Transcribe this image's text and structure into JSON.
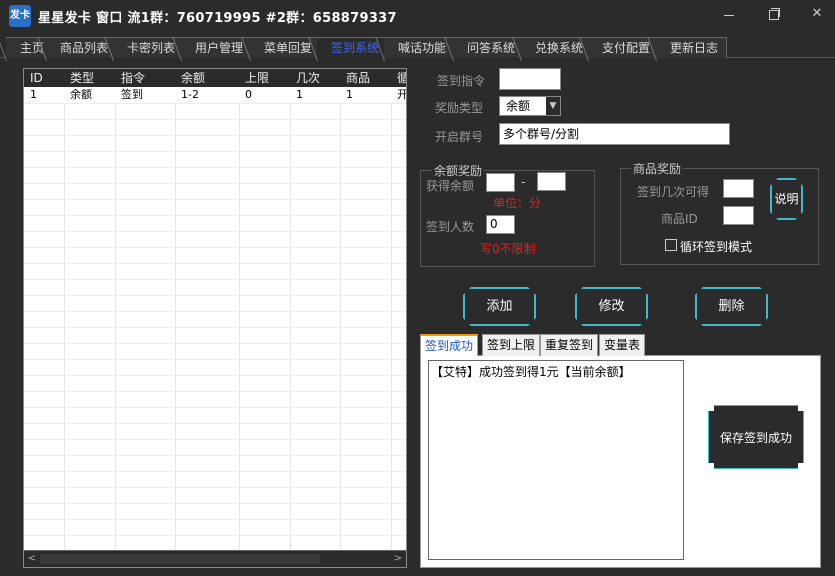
{
  "window": {
    "icon_text": "发卡",
    "title": "星星发卡 窗口 流1群：760719995 #2群：658879337"
  },
  "tabs": [
    {
      "label": "主页"
    },
    {
      "label": "商品列表"
    },
    {
      "label": "卡密列表"
    },
    {
      "label": "用户管理"
    },
    {
      "label": "菜单回复"
    },
    {
      "label": "签到系统"
    },
    {
      "label": "喊话功能"
    },
    {
      "label": "问答系统"
    },
    {
      "label": "兑换系统"
    },
    {
      "label": "支付配置"
    },
    {
      "label": "更新日志"
    }
  ],
  "active_tab": "签到系统",
  "table": {
    "columns": [
      "ID",
      "类型",
      "指令",
      "余额",
      "上限",
      "几次",
      "商品",
      "循"
    ],
    "rows": [
      [
        "1",
        "余额",
        "签到",
        "1-2",
        "0",
        "1",
        "1",
        "开"
      ]
    ]
  },
  "form": {
    "signin_cmd_label": "签到指令",
    "signin_cmd_value": "",
    "reward_type_label": "奖励类型",
    "reward_type_value": "余额",
    "group_label": "开启群号",
    "group_value": "多个群号/分割"
  },
  "balance_reward": {
    "title": "余额奖励",
    "get_balance_label": "获得余额",
    "min_value": "",
    "dash": "-",
    "max_value": "",
    "unit_note": "单位：分",
    "signin_count_label": "签到人数",
    "signin_count_value": "0",
    "zero_note": "写0不限制"
  },
  "product_reward": {
    "title": "商品奖励",
    "times_label": "签到几次可得",
    "times_value": "",
    "product_id_label": "商品ID",
    "product_id_value": "",
    "help_button": "说明",
    "loop_label": "循环签到模式"
  },
  "actions": {
    "add": "添加",
    "edit": "修改",
    "delete": "删除"
  },
  "subtabs": [
    {
      "label": "签到成功"
    },
    {
      "label": "签到上限"
    },
    {
      "label": "重复签到"
    },
    {
      "label": "变量表"
    }
  ],
  "message_text": "【艾特】成功签到得1元【当前余额】",
  "save_button": "保存签到成功"
}
